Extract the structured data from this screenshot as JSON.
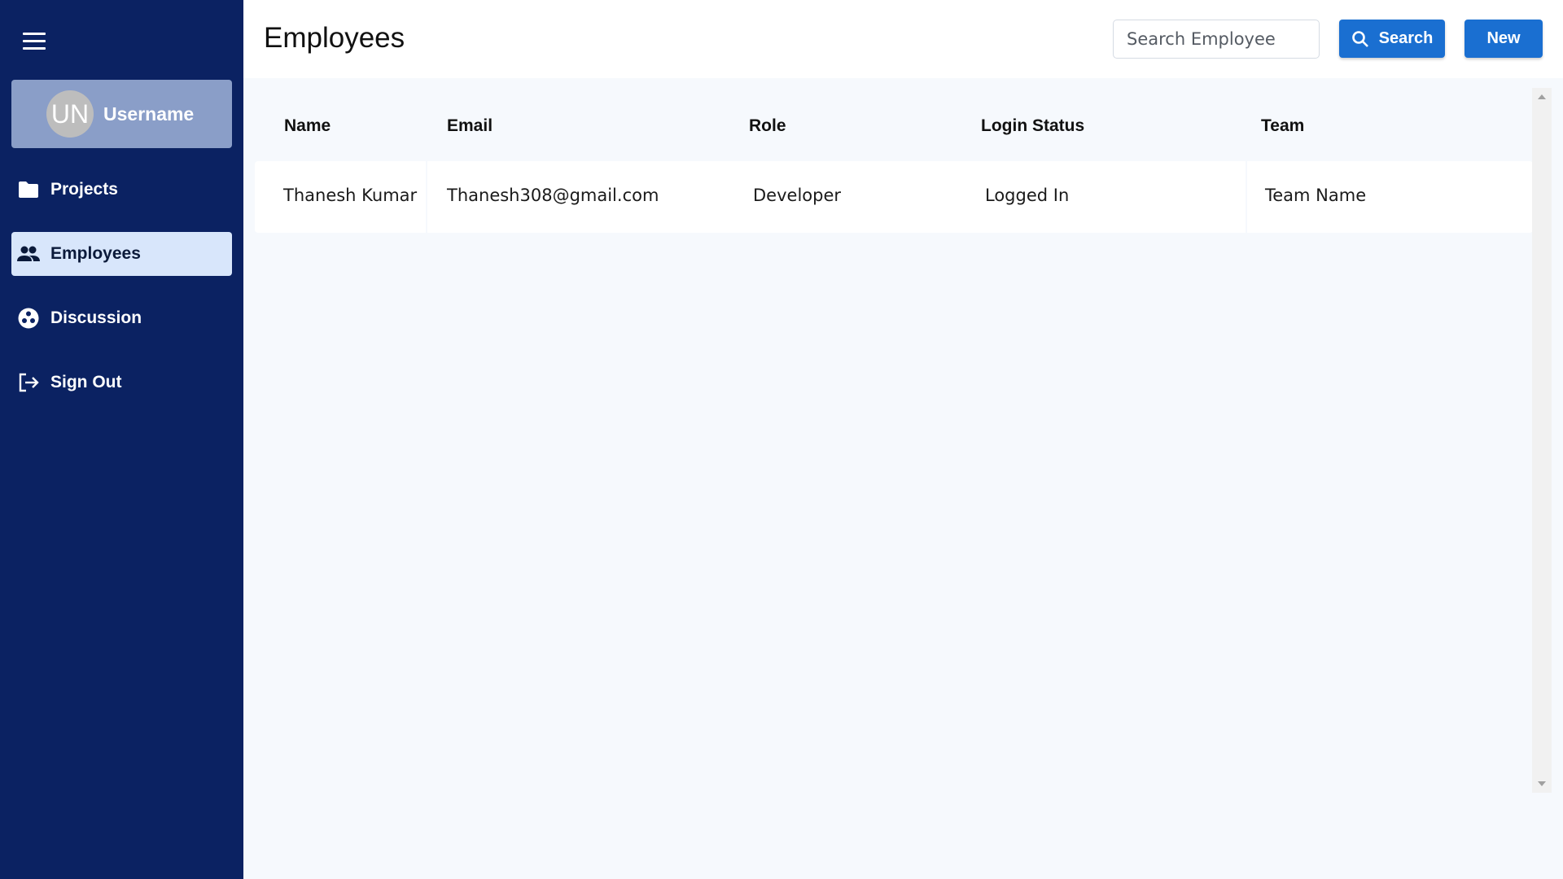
{
  "sidebar": {
    "user": {
      "initials": "UN",
      "name": "Username"
    },
    "items": [
      {
        "label": "Projects",
        "icon": "folder-icon"
      },
      {
        "label": "Employees",
        "icon": "people-icon",
        "active": true
      },
      {
        "label": "Discussion",
        "icon": "discussion-icon"
      },
      {
        "label": "Sign Out",
        "icon": "sign-out-icon"
      }
    ]
  },
  "header": {
    "title": "Employees",
    "search_placeholder": "Search Employee",
    "search_value": "",
    "search_button_label": "Search",
    "new_button_label": "New"
  },
  "table": {
    "columns": [
      "Name",
      "Email",
      "Role",
      "Login Status",
      "Team"
    ],
    "rows": [
      [
        "Thanesh Kumar",
        "Thanesh308@gmail.com",
        "Developer",
        "Logged In",
        "Team Name"
      ]
    ]
  },
  "colors": {
    "sidebar_bg": "#0b2262",
    "user_card_bg": "#8a9ec8",
    "active_item_bg": "#d8e6fb",
    "primary_button": "#1a6fd1",
    "content_bg": "#f6f9fd"
  }
}
